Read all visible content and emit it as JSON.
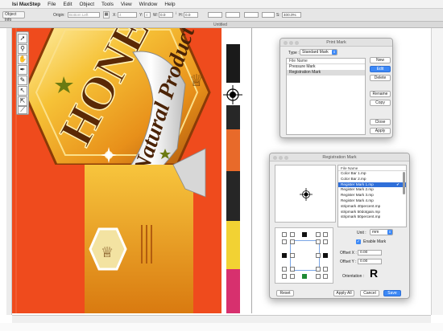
{
  "colors": {
    "artwork_bg": "#ef4b1d",
    "honey_gold": "#f0a61b",
    "honey_dark": "#7a3a0a",
    "accent_blue": "#3c88f6",
    "strip_colors": [
      "#ffffff",
      "#1a1a1a",
      "#ffffff",
      "#272727",
      "#e86a2a",
      "#262626",
      "#f2d233",
      "#d7306e"
    ]
  },
  "menubar": {
    "apple": "",
    "app_name": "Isi MaxStep",
    "items": [
      "File",
      "Edit",
      "Object",
      "Tools",
      "View",
      "Window",
      "Help"
    ]
  },
  "toolbar": {
    "object_info": "Object Info",
    "origin_label": "Origin:",
    "origin_value": "Bottom Left",
    "x_label": "X:",
    "x_value": "4",
    "y_label": "Y:",
    "y_value": "4",
    "w_label": "W:",
    "w_value": "0.0",
    "h_label": "H:",
    "h_value": "0.0",
    "s_label": "S:",
    "s_value": "400.0%"
  },
  "document": {
    "title": "Untitled"
  },
  "artwork": {
    "brand": "HONEY",
    "tagline": "Natural Product"
  },
  "tools": [
    "arrow-tool",
    "zoom-tool",
    "hand-tool",
    "pen-tool",
    "pencil-tool",
    "direct-select-tool",
    "group-select-tool",
    "measure-tool"
  ],
  "print_mark_dialog": {
    "title": "Print Mark",
    "type_label": "Type :",
    "type_value": "Standard Mark",
    "list_header": "File Name",
    "items": [
      "Pressure Mark",
      "Registration Mark"
    ],
    "selected_index": 1,
    "buttons": [
      "New",
      "Edit",
      "Delete",
      "Rename",
      "Copy",
      "Close",
      "Apply"
    ]
  },
  "registration_dialog": {
    "title": "Registration Mark",
    "list_header": "File Name",
    "items": [
      "Color Bar 1.mp",
      "Color Bar 2.mp",
      "Register Mark 1.mp",
      "Register Mark 2.mp",
      "Register Mark 3.mp",
      "Register Mark 4.mp",
      "stripmark 40percent.mp",
      "stripmark 50dotgain.mp",
      "stripmark 50percent.mp"
    ],
    "selected_index": 2,
    "unit_label": "Unit :",
    "unit_value": "mm",
    "enable_label": "Enable Mark",
    "offset_x_label": "Offset X :",
    "offset_x_value": "0.00",
    "offset_y_label": "Offset Y :",
    "offset_y_value": "0.00",
    "orientation_label": "Orientation :",
    "orientation_value": "R",
    "buttons": {
      "reset": "Reset",
      "apply_all": "Apply All",
      "cancel": "Cancel",
      "save": "Save"
    }
  }
}
